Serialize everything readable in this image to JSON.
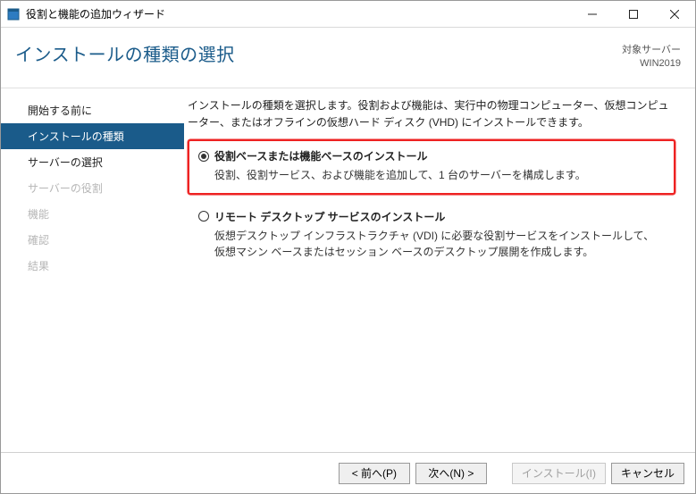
{
  "titlebar": {
    "title": "役割と機能の追加ウィザード"
  },
  "header": {
    "title": "インストールの種類の選択",
    "target_label": "対象サーバー",
    "target_value": "WIN2019"
  },
  "sidebar": {
    "items": [
      {
        "label": "開始する前に",
        "state": "normal"
      },
      {
        "label": "インストールの種類",
        "state": "active"
      },
      {
        "label": "サーバーの選択",
        "state": "normal"
      },
      {
        "label": "サーバーの役割",
        "state": "disabled"
      },
      {
        "label": "機能",
        "state": "disabled"
      },
      {
        "label": "確認",
        "state": "disabled"
      },
      {
        "label": "結果",
        "state": "disabled"
      }
    ]
  },
  "content": {
    "description": "インストールの種類を選択します。役割および機能は、実行中の物理コンピューター、仮想コンピューター、またはオフラインの仮想ハード ディスク (VHD) にインストールできます。",
    "options": [
      {
        "id": "role-based",
        "selected": true,
        "highlighted": true,
        "title": "役割ベースまたは機能ベースのインストール",
        "desc": "役割、役割サービス、および機能を追加して、1 台のサーバーを構成します。"
      },
      {
        "id": "rds",
        "selected": false,
        "highlighted": false,
        "title": "リモート デスクトップ サービスのインストール",
        "desc": "仮想デスクトップ インフラストラクチャ (VDI) に必要な役割サービスをインストールして、仮想マシン ベースまたはセッション ベースのデスクトップ展開を作成します。"
      }
    ]
  },
  "footer": {
    "prev": "< 前へ(P)",
    "next": "次へ(N) >",
    "install": "インストール(I)",
    "cancel": "キャンセル"
  }
}
